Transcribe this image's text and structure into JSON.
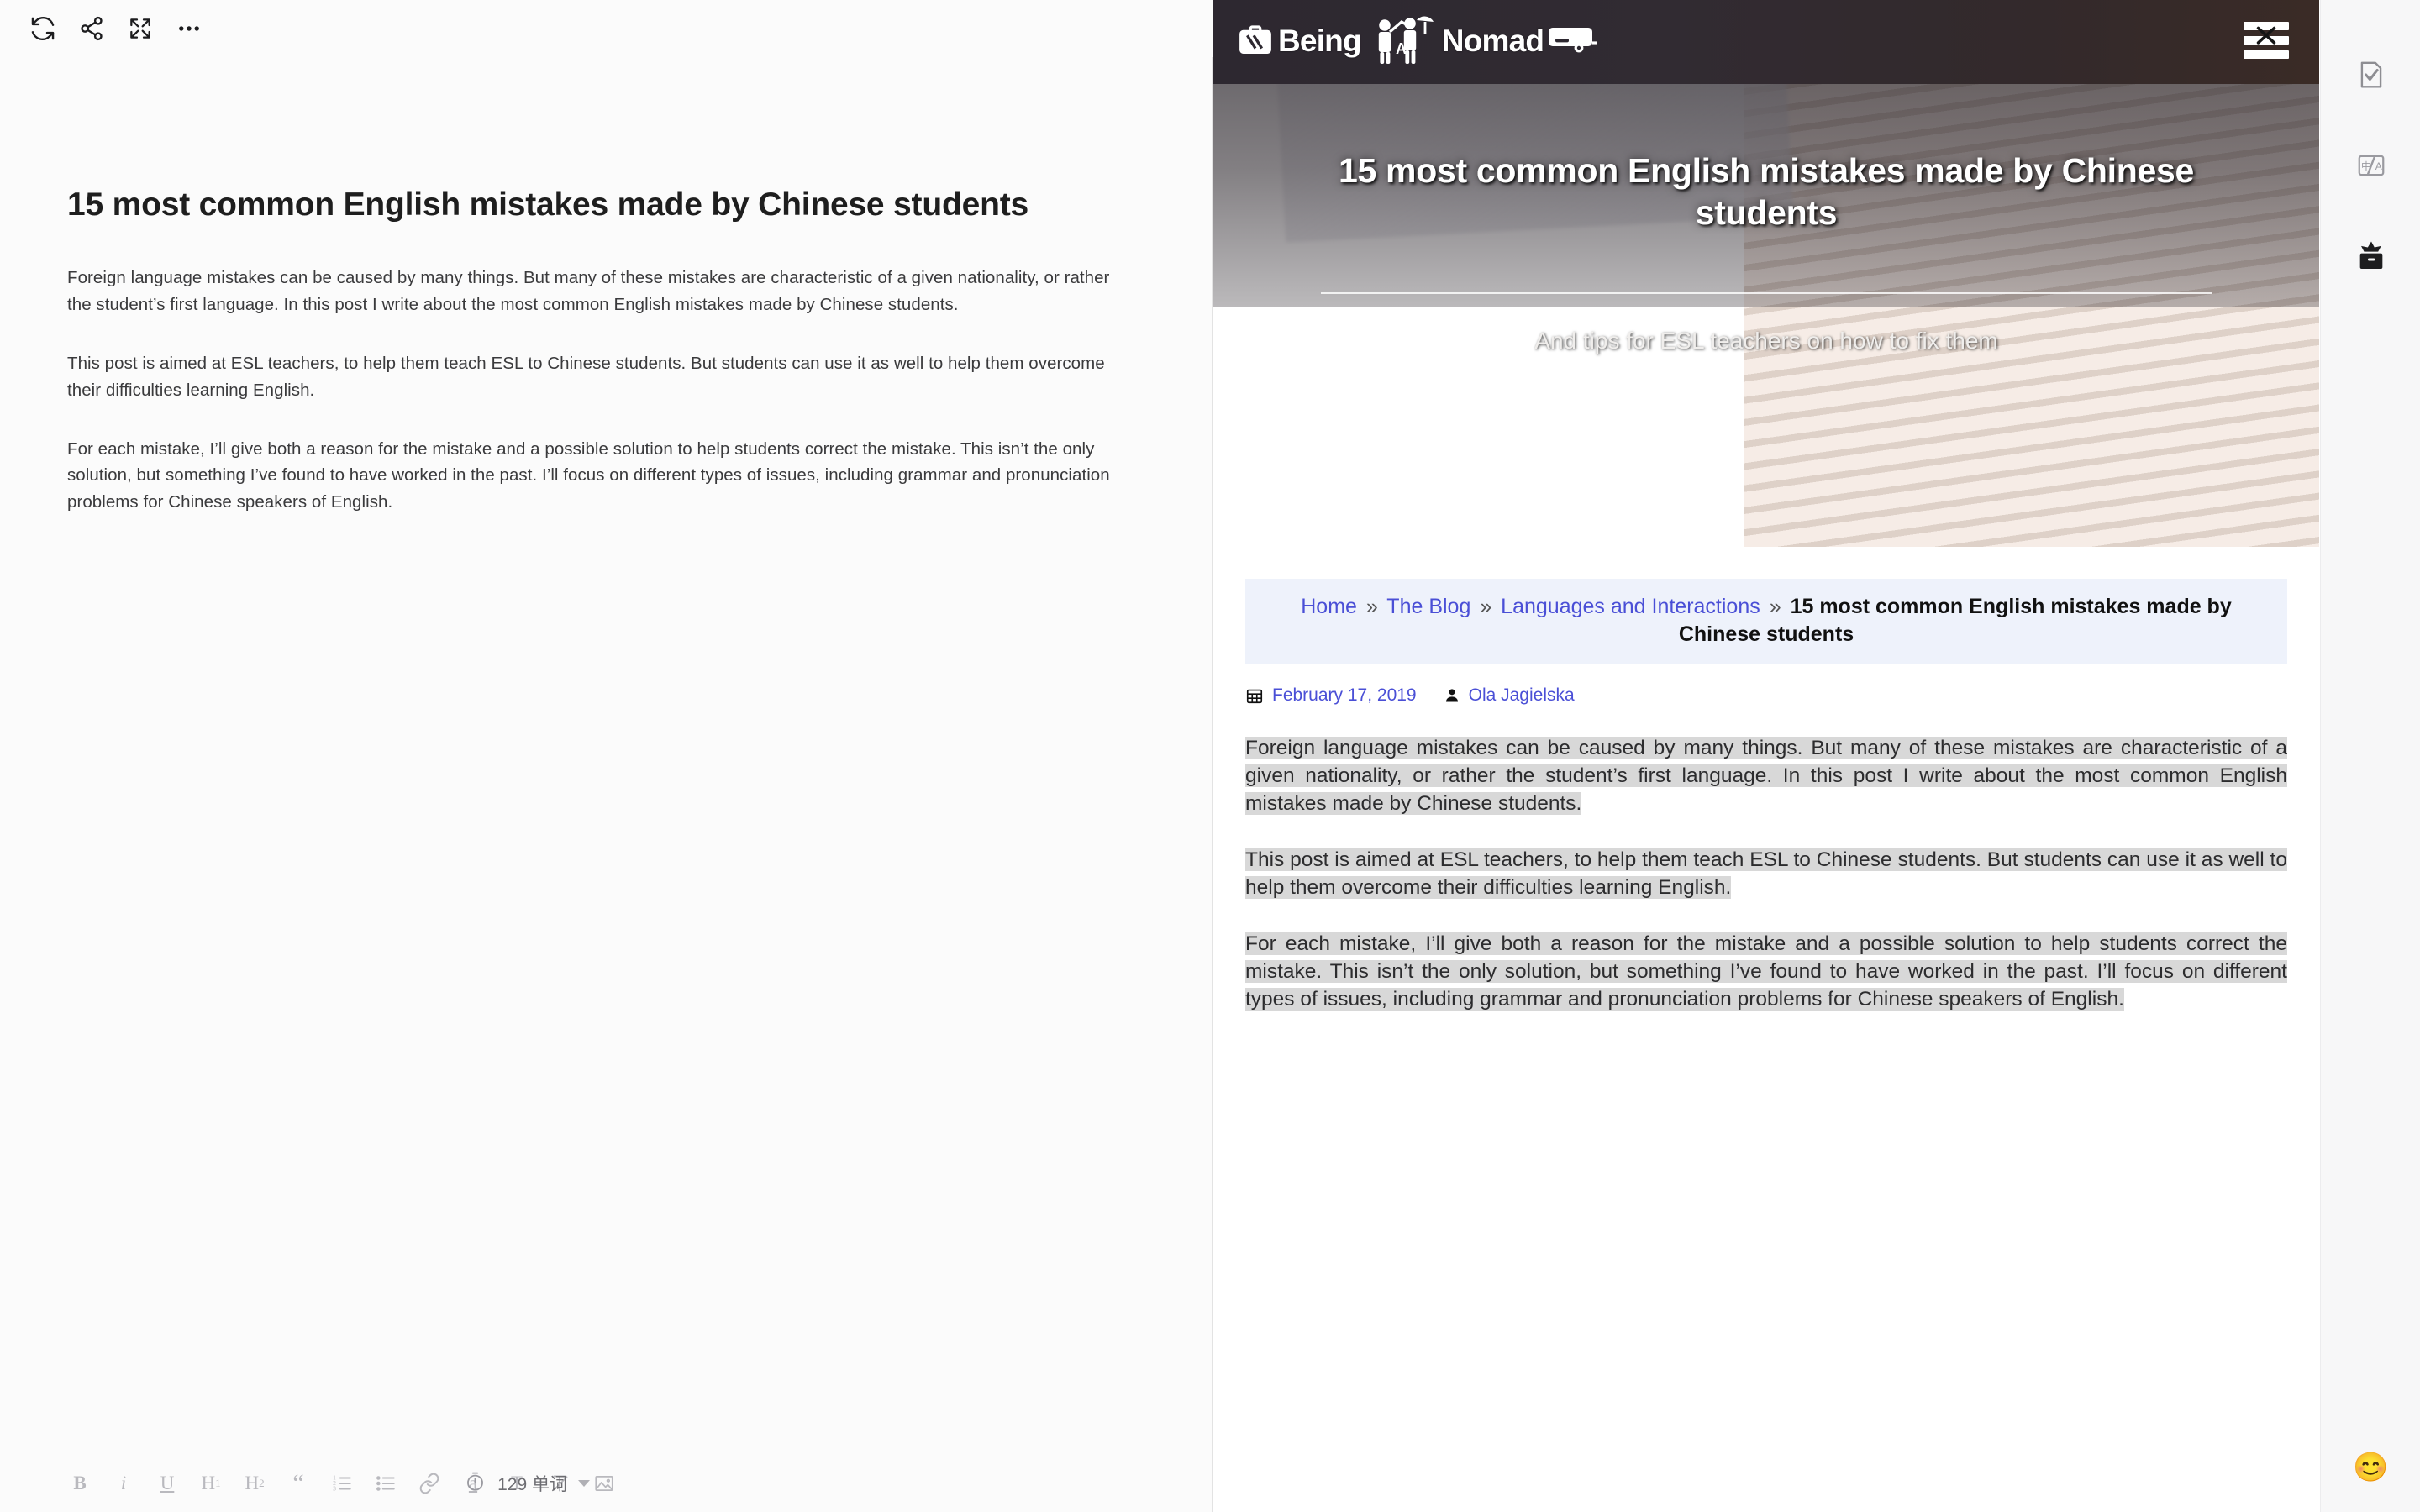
{
  "editor": {
    "toolbar_top": [
      {
        "name": "refresh-sync-icon",
        "label": "Sync"
      },
      {
        "name": "share-icon",
        "label": "Share"
      },
      {
        "name": "fullscreen-icon",
        "label": "Fullscreen"
      },
      {
        "name": "more-options-icon",
        "label": "More"
      }
    ],
    "title": "15 most common English mistakes made by Chinese students",
    "paragraphs": [
      "Foreign language mistakes can be caused by many things. But many of these mistakes are characteristic of a given nationality, or rather the student’s first language. In this post I write about the most common English mistakes made by Chinese students.",
      "This post is aimed at ESL teachers, to help them teach ESL to Chinese students. But students can use it as well to help them overcome their difficulties learning English.",
      "For each mistake, I’ll give both a reason for the mistake and a possible solution to help students correct the mistake. This isn’t the only solution, but something I’ve found to have worked in the past. I’ll focus on different types of issues, including grammar and pronunciation problems for Chinese speakers of English."
    ],
    "format_toolbar": [
      {
        "name": "bold-button",
        "label": "B"
      },
      {
        "name": "italic-button",
        "label": "i"
      },
      {
        "name": "underline-button",
        "label": "U"
      },
      {
        "name": "heading-1-button",
        "label": "H",
        "sub": "1"
      },
      {
        "name": "heading-2-button",
        "label": "H",
        "sub": "2"
      },
      {
        "name": "blockquote-button",
        "label": "“"
      },
      {
        "name": "ordered-list-button",
        "label": ""
      },
      {
        "name": "unordered-list-button",
        "label": ""
      },
      {
        "name": "link-button",
        "label": ""
      },
      {
        "name": "highlight-button",
        "label": "a"
      },
      {
        "name": "text-style-button",
        "label": "T"
      },
      {
        "name": "clear-format-button",
        "label": ""
      },
      {
        "name": "insert-image-button",
        "label": ""
      }
    ],
    "word_count": "129 单词"
  },
  "preview": {
    "site_logo": {
      "text_1": "Being",
      "letter": "A",
      "text_2": "Nomad"
    },
    "hero": {
      "title": "15 most common English mistakes made by Chinese students",
      "subtitle": "And tips for ESL teachers on how to fix them"
    },
    "breadcrumb": {
      "items": [
        {
          "label": "Home",
          "link": true
        },
        {
          "label": "The Blog",
          "link": true
        },
        {
          "label": "Languages and Interactions",
          "link": true
        }
      ],
      "separator": "»",
      "current": "15 most common English mistakes made by Chinese students"
    },
    "meta": {
      "date": "February 17, 2019",
      "author": "Ola Jagielska"
    },
    "paragraphs": [
      "Foreign language mistakes can be caused by many things. But many of these mistakes are characteristic of a given nationality, or rather the student’s first language. In this post I write about the most common English mistakes made by Chinese students.",
      "This post is aimed at ESL teachers, to help them teach ESL to Chinese students. But students can use it as well to help them overcome their difficulties learning English.",
      "For each mistake, I’ll give both a reason for the mistake and a possible solution to help students correct the mistake. This isn’t the only solution, but something I’ve found to have worked in the past. I’ll focus on different types of issues, including grammar and pronunciation problems for Chinese speakers of English."
    ]
  },
  "rail": {
    "items": [
      {
        "name": "document-check-icon",
        "label": "Proofread"
      },
      {
        "name": "translate-icon",
        "label": "Translate"
      },
      {
        "name": "archive-box-icon",
        "label": "Publish"
      }
    ],
    "emoji": "😊"
  },
  "colors": {
    "link": "#4a4fd6",
    "header_dark": "#2d2830",
    "selection": "#d8d8d8",
    "breadcrumb_bg": "#eef2fb"
  }
}
